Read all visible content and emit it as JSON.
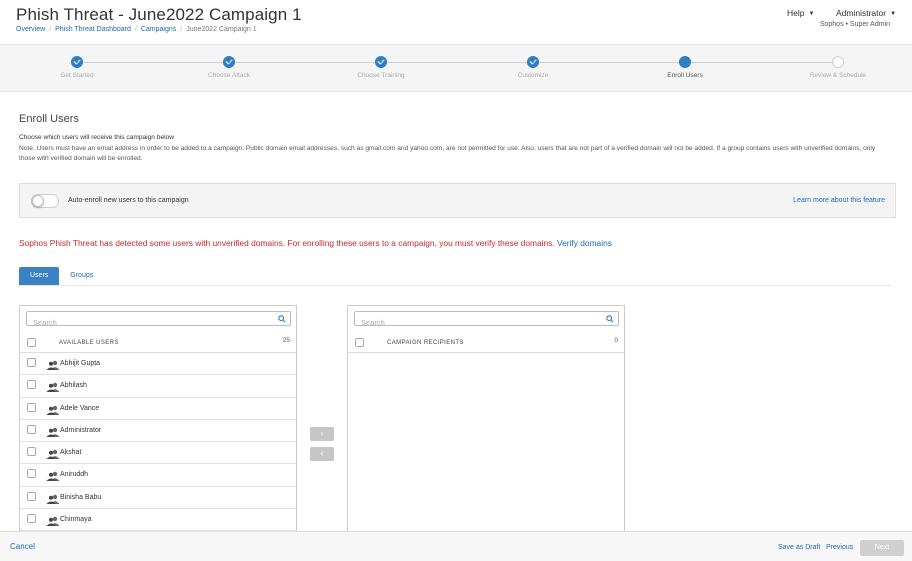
{
  "header": {
    "title": "Phish Threat - June2022 Campaign 1",
    "breadcrumb": [
      "Overview",
      "Phish Threat Dashboard",
      "Campaigns",
      "June2022 Campaign 1"
    ],
    "help_label": "Help",
    "admin_label": "Administrator",
    "org_line": "Sophos • Super Admin"
  },
  "stepper": {
    "steps": [
      {
        "label": "Get Started",
        "state": "done"
      },
      {
        "label": "Choose Attack",
        "state": "done"
      },
      {
        "label": "Choose Training",
        "state": "done"
      },
      {
        "label": "Customize",
        "state": "done"
      },
      {
        "label": "Enroll Users",
        "state": "current"
      },
      {
        "label": "Review & Schedule",
        "state": "todo"
      }
    ]
  },
  "content": {
    "section_title": "Enroll Users",
    "subtitle": "Choose which users will receive this campaign below",
    "note": "Note: Users must have an email address in order to be added to a campaign. Public domain email addresses, such as gmail.com and yahoo.com, are not permitted for use. Also, users that are not part of a verified domain will not be added. If a group contains users with unverified domains, only those with verified domain will be enrolled.",
    "auto_enroll_label": "Auto-enroll new users to this campaign",
    "auto_enroll_enabled": false,
    "learn_more": "Learn more about this feature",
    "warning_text": "Sophos Phish Threat has detected some users with unverified domains. For enrolling these users to a campaign, you must verify these domains.",
    "verify_link": "Verify domains",
    "tabs": [
      "Users",
      "Groups"
    ]
  },
  "available": {
    "search_placeholder": "Search",
    "header": "AVAILABLE USERS",
    "count": "25",
    "users": [
      "Abhijit Gupta",
      "Abhilash",
      "Adele Vance",
      "Administrator",
      "Akshat",
      "Aniruddh",
      "Binisha Babu",
      "Chinmaya"
    ]
  },
  "recipients": {
    "search_placeholder": "Search",
    "header": "CAMPAIGN RECIPIENTS",
    "count": "0"
  },
  "move_buttons": {
    "add": "›",
    "remove": "‹"
  },
  "footer": {
    "cancel": "Cancel",
    "save_draft": "Save as Draft",
    "previous": "Previous",
    "next": "Next"
  },
  "colors": {
    "accent": "#2f7fc1",
    "link": "#1b6ab5",
    "warning": "#c62828"
  },
  "icons": {
    "search": "search-icon",
    "user": "user-group-icon",
    "check": "check-icon"
  }
}
